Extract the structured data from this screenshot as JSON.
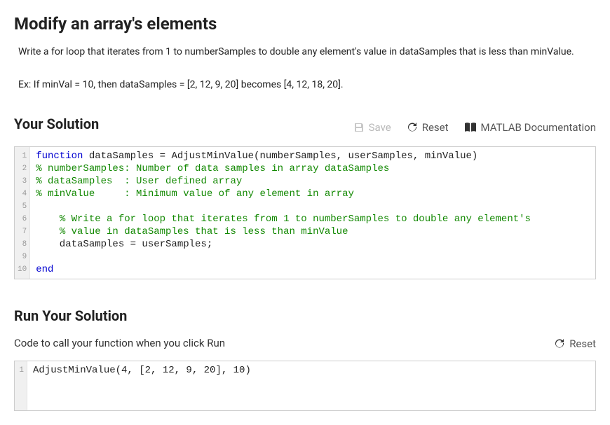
{
  "title": "Modify an array's elements",
  "problem": "Write a for loop that iterates from 1 to numberSamples to double any element's value in dataSamples that is less than minValue.",
  "example": "Ex: If minVal = 10, then dataSamples = [2, 12, 9, 20] becomes [4, 12, 18, 20].",
  "solution_heading": "Your Solution",
  "toolbar": {
    "save_label": "Save",
    "reset_label": "Reset",
    "docs_label": "MATLAB Documentation"
  },
  "code": {
    "lines": [
      {
        "n": 1,
        "segs": [
          {
            "t": "function",
            "c": "kw"
          },
          {
            "t": " dataSamples = AdjustMinValue(numberSamples, userSamples, minValue)",
            "c": ""
          }
        ]
      },
      {
        "n": 2,
        "segs": [
          {
            "t": "% numberSamples: Number of data samples in array dataSamples",
            "c": "com"
          }
        ]
      },
      {
        "n": 3,
        "segs": [
          {
            "t": "% dataSamples  : User defined array",
            "c": "com"
          }
        ]
      },
      {
        "n": 4,
        "segs": [
          {
            "t": "% minValue     : Minimum value of any element in array",
            "c": "com"
          }
        ]
      },
      {
        "n": 5,
        "segs": [
          {
            "t": "",
            "c": ""
          }
        ]
      },
      {
        "n": 6,
        "segs": [
          {
            "t": "    ",
            "c": ""
          },
          {
            "t": "% Write a for loop that iterates from 1 to numberSamples to double any element's",
            "c": "com"
          }
        ]
      },
      {
        "n": 7,
        "segs": [
          {
            "t": "    ",
            "c": ""
          },
          {
            "t": "% value in dataSamples that is less than minValue",
            "c": "com"
          }
        ]
      },
      {
        "n": 8,
        "segs": [
          {
            "t": "    dataSamples = userSamples;",
            "c": ""
          }
        ]
      },
      {
        "n": 9,
        "segs": [
          {
            "t": "",
            "c": ""
          }
        ]
      },
      {
        "n": 10,
        "segs": [
          {
            "t": "end",
            "c": "kw"
          }
        ]
      }
    ]
  },
  "run_heading": "Run Your Solution",
  "run_subtitle": "Code to call your function when you click Run",
  "run_reset_label": "Reset",
  "call_code": {
    "lines": [
      {
        "n": 1,
        "segs": [
          {
            "t": "AdjustMinValue(4, [2, 12, 9, 20], 10)",
            "c": ""
          }
        ]
      }
    ]
  }
}
